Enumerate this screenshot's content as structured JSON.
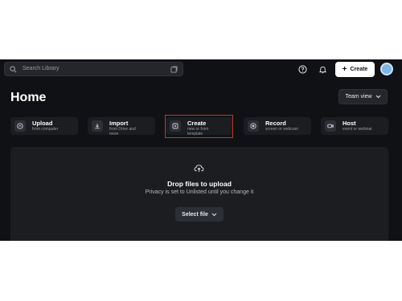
{
  "search": {
    "placeholder": "Search Library"
  },
  "header": {
    "create_label": "Create"
  },
  "page": {
    "title": "Home",
    "team_view_label": "Team view"
  },
  "actions": [
    {
      "label": "Upload",
      "sub1": "from computer",
      "sub2": "",
      "icon": "upload-circle-icon"
    },
    {
      "label": "Import",
      "sub1": "from Drive and",
      "sub2": "more",
      "icon": "import-icon"
    },
    {
      "label": "Create",
      "sub1": "new or from",
      "sub2": "template",
      "icon": "create-doc-icon"
    },
    {
      "label": "Record",
      "sub1": "screen or webcam",
      "sub2": "",
      "icon": "record-icon"
    },
    {
      "label": "Host",
      "sub1": "event or webinar",
      "sub2": "",
      "icon": "camera-icon"
    }
  ],
  "dropzone": {
    "title": "Drop files to upload",
    "privacy": "Privacy is set to Unlisted until you change it",
    "select_label": "Select file"
  },
  "colors": {
    "background": "#101114",
    "card": "#1b1d21",
    "highlight": "#c0392b"
  }
}
